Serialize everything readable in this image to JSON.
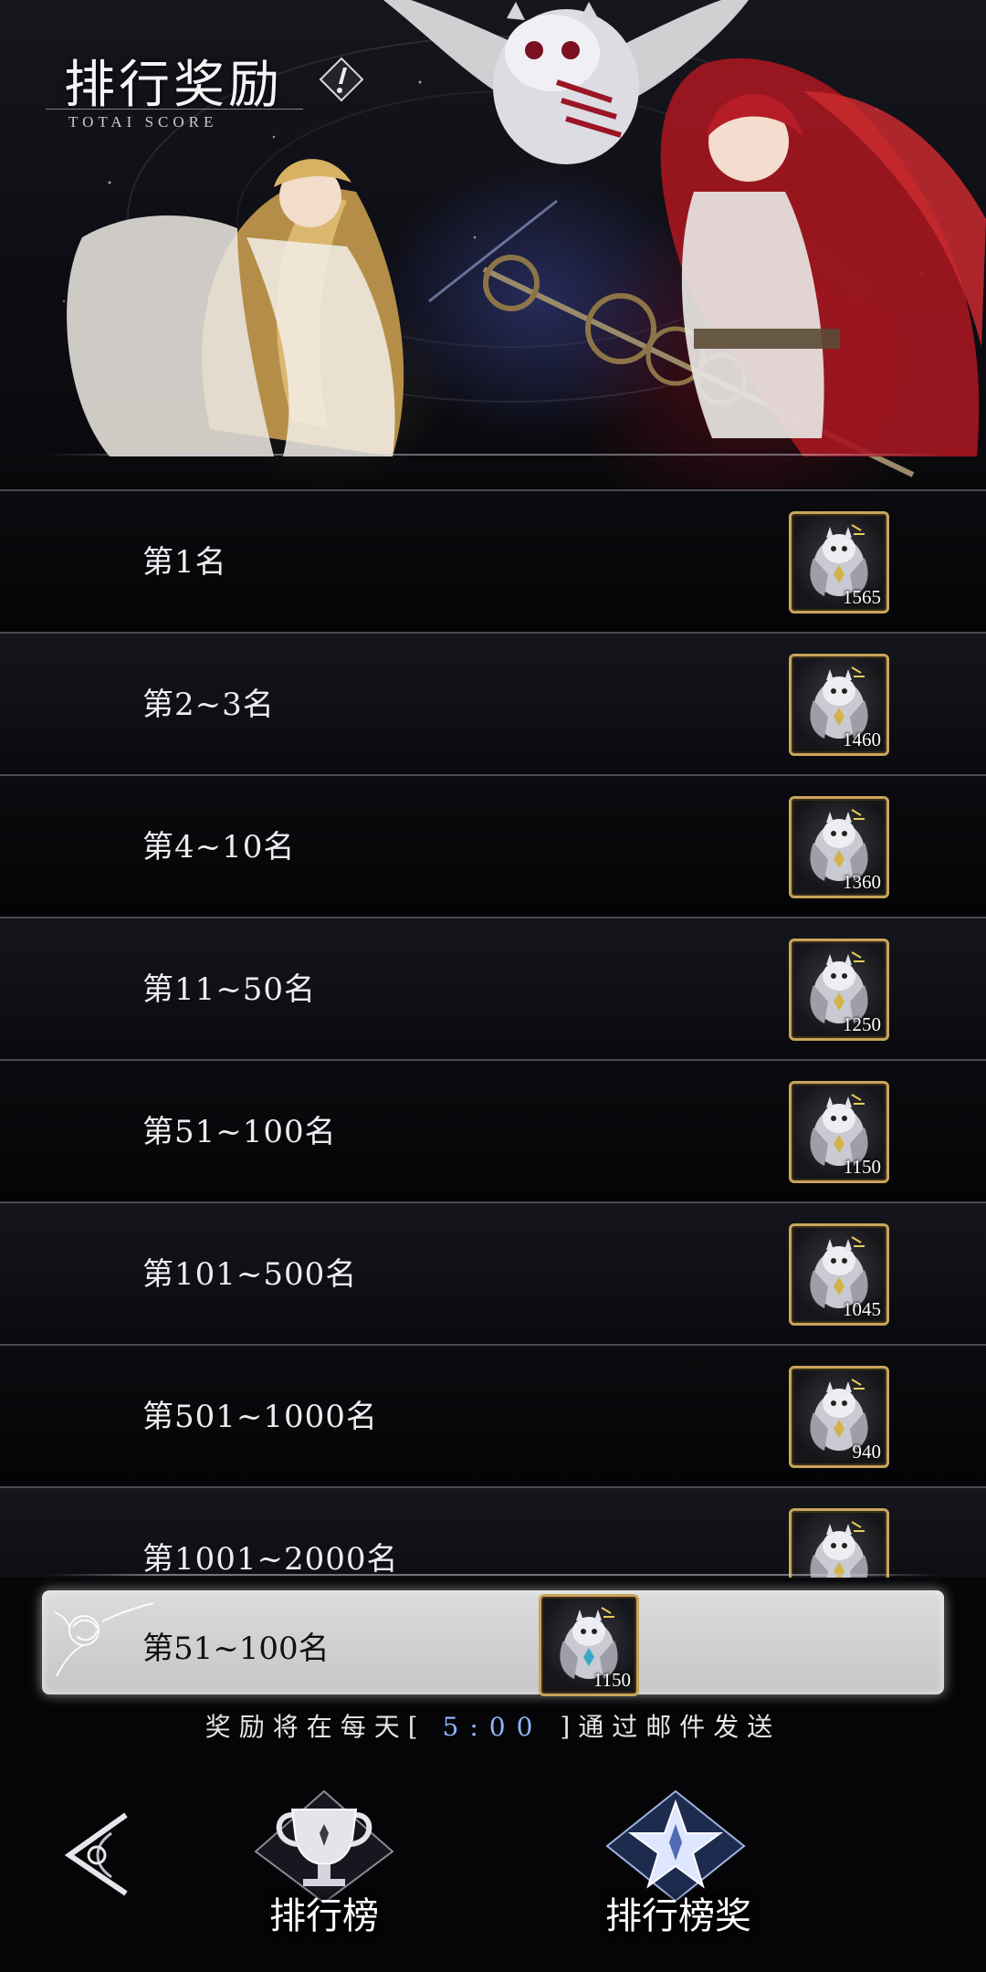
{
  "header": {
    "title": "排行奖励",
    "subtitle": "TOTAI SCORE",
    "info_icon": "info-diamond-icon"
  },
  "rewards": [
    {
      "rank": "第1名",
      "item_icon": "owl-emblem-icon",
      "amount": "1565"
    },
    {
      "rank": "第2~3名",
      "item_icon": "owl-emblem-icon",
      "amount": "1460"
    },
    {
      "rank": "第4~10名",
      "item_icon": "owl-emblem-icon",
      "amount": "1360"
    },
    {
      "rank": "第11~50名",
      "item_icon": "owl-emblem-icon",
      "amount": "1250"
    },
    {
      "rank": "第51~100名",
      "item_icon": "owl-emblem-icon",
      "amount": "1150"
    },
    {
      "rank": "第101~500名",
      "item_icon": "owl-emblem-icon",
      "amount": "1045"
    },
    {
      "rank": "第501~1000名",
      "item_icon": "owl-emblem-icon",
      "amount": "940"
    },
    {
      "rank": "第1001~2000名",
      "item_icon": "owl-emblem-icon",
      "amount": ""
    }
  ],
  "my_rank": {
    "rank": "第51~100名",
    "item_icon": "owl-emblem-icon",
    "amount": "1150"
  },
  "notice": {
    "prefix": "奖励将在每天[",
    "time": "5:00",
    "suffix": "]通过邮件发送"
  },
  "nav": {
    "back_icon": "back-arrow-icon",
    "ranking_label": "排行榜",
    "ranking_icon": "trophy-icon",
    "reward_label": "排行榜奖",
    "reward_icon": "star-icon"
  },
  "colors": {
    "gold_frame": "#c9a45c",
    "time_highlight": "#8fb2ff",
    "panel_bg": "#d2d2d2"
  }
}
